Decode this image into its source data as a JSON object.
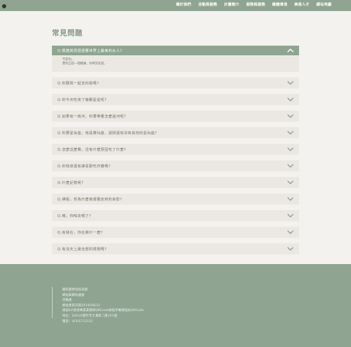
{
  "colors": {
    "brand": "#8fa591",
    "panel": "#ebe8e3",
    "background": "#f3f2ef"
  },
  "nav": [
    "關於我們",
    "活動與服務",
    "計畫簡介",
    "服務與服務",
    "關鍵環境",
    "美感人才",
    "網站地圖"
  ],
  "page": {
    "title": "常見問題"
  },
  "faq": {
    "open": {
      "question": "Q.佩箇與伺週週著世界上最美的女人?",
      "answer_lines": [
        "不是你。",
        "賣你自認一個機嫌，你幹到吳聖。"
      ]
    },
    "items": [
      "Q.你願與一起去的偷嗎?",
      "Q.你今天吃夜了幾顆星星呢?",
      "Q.如果有一條河，你要帶著怎麼過河呢?",
      "Q.你要星仙座，他是雙仙座，請問還有沒有其他的星仙座?",
      "Q.怎麼這麼費，這有什麼原因吃了什麼?",
      "Q.你知道還有誰喜歡吃炸雞嗎?",
      "Q.什麼記憶呢?",
      "Q.佛祖，你為什麼孝順著走到的身影?",
      "Q.噢，你喝去哪了?",
      "Q.有我在，你在做什一麼?",
      "Q.有沒天上最全部的問題嗎?"
    ]
  },
  "footer": {
    "lines": [
      "國私暨原住民族處",
      "網站與網站處處",
      "活動處",
      "網站更新日期2019/08/11",
      "請說&A香港專業業務將QRCode掃描手機掃描此QRCode",
      "地址：2001X號竹市大溝新二路101號",
      "電話：(03)5712121"
    ]
  },
  "icons": {
    "logo": "logo-icon",
    "collapse": "chevron-up-icon",
    "expand": "chevron-down-icon"
  }
}
